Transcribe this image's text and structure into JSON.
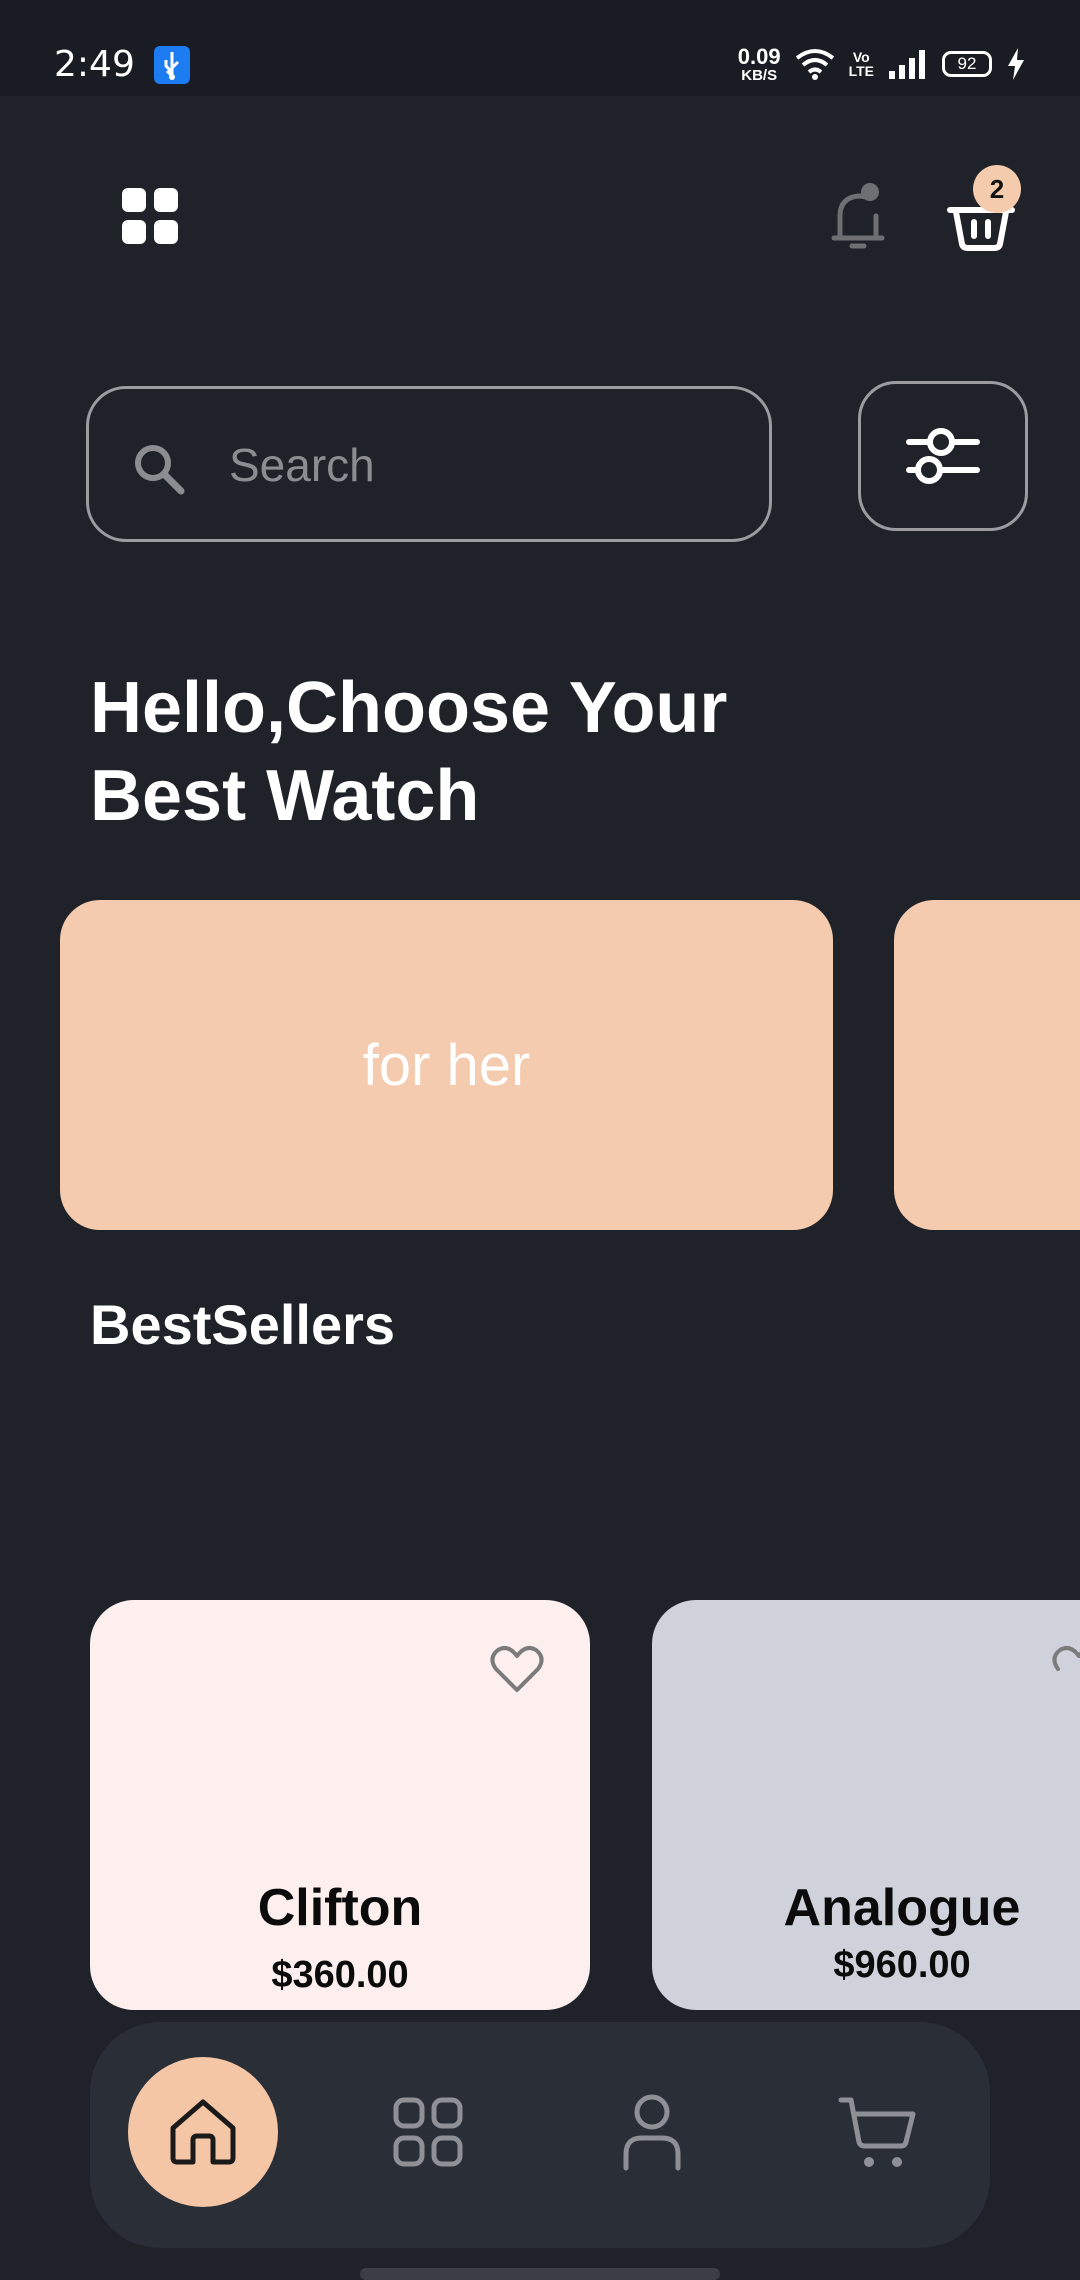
{
  "status_bar": {
    "time": "2:49",
    "net_speed_value": "0.09",
    "net_speed_unit": "KB/S",
    "volte_top": "Vo",
    "volte_bottom": "LTE",
    "battery": "92"
  },
  "header": {
    "menu_icon": "grid-icon",
    "bell_icon": "bell-icon",
    "cart_icon": "basket-icon",
    "cart_count": "2"
  },
  "search": {
    "placeholder": "Search",
    "value": ""
  },
  "hero": {
    "title": "Hello,Choose Your Best Watch"
  },
  "categories": [
    {
      "label": "for her"
    },
    {
      "label": ""
    }
  ],
  "bestsellers": {
    "title": "BestSellers",
    "products": [
      {
        "name": "Clifton",
        "price": "$360.00",
        "bg": "#fcefed"
      },
      {
        "name": "Analogue",
        "price": "$960.00",
        "bg": "#cfd2da"
      }
    ]
  },
  "bottom_nav": {
    "items": [
      {
        "name": "home",
        "icon": "home-icon",
        "active": true
      },
      {
        "name": "categories",
        "icon": "apps-icon",
        "active": false
      },
      {
        "name": "profile",
        "icon": "user-icon",
        "active": false
      },
      {
        "name": "cart",
        "icon": "cart-icon",
        "active": false
      }
    ]
  },
  "colors": {
    "background": "#1f2229",
    "accent": "#f4cbae",
    "nav_bg": "#2a2e37"
  }
}
